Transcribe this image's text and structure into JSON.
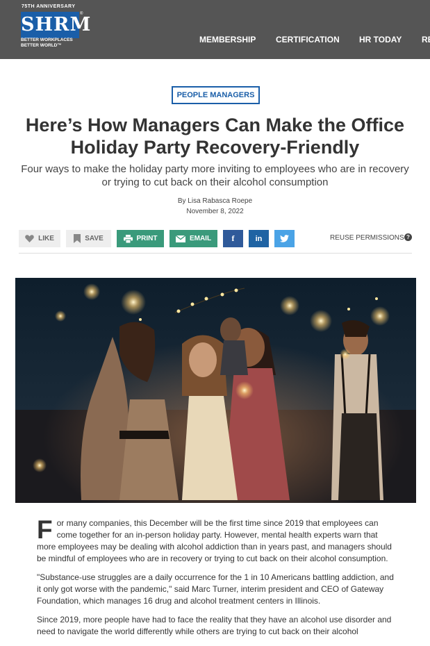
{
  "header": {
    "logo": {
      "anniversary": "75TH ANNIVERSARY",
      "wordmark": "SHRM",
      "registered": "®",
      "tagline_line1": "BETTER WORKPLACES",
      "tagline_line2": "BETTER WORLD™"
    },
    "nav": [
      "MEMBERSHIP",
      "CERTIFICATION",
      "HR TODAY",
      "RE"
    ],
    "background_color": "#555555",
    "brand_color": "#1a5ea8"
  },
  "article": {
    "category": "PEOPLE MANAGERS",
    "title_line1": "Here’s How Managers Can Make the Office",
    "title_line2": "Holiday Party Recovery-Friendly",
    "subtitle_line1": "Four ways to make the holiday party more inviting to employees who are in recovery",
    "subtitle_line2": "or trying to cut back on their alcohol consumption",
    "byline": "By Lisa Rabasca Roepe",
    "date": "November 8, 2022"
  },
  "actions": {
    "like": "LIKE",
    "save": "SAVE",
    "print": "PRINT",
    "email": "EMAIL",
    "facebook": "f",
    "linkedin": "in",
    "twitter_icon": "twitter-icon",
    "reuse": "REUSE PERMISSIONS",
    "help": "?",
    "colors": {
      "share_green": "#3a9a7b",
      "facebook": "#2f5a9a",
      "linkedin": "#1f63a3",
      "twitter": "#4aa3e6"
    }
  },
  "body": {
    "dropcap": "F",
    "paragraph1": "or many companies, this December will be the first time since 2019 that employees can come together for an in-person holiday party. However, mental health experts warn that more employees may be dealing with alcohol addiction than in years past, and managers should be mindful of employees who are in recovery or trying to cut back on their alcohol consumption.",
    "paragraph2": "\"Substance-use struggles are a daily occurrence for the 1 in 10 Americans battling addiction, and it only got worse with the pandemic,\" said Marc Turner, interim president and CEO of Gateway Foundation, which manages 16 drug and alcohol treatment centers in Illinois.",
    "paragraph3": "Since 2019, more people have had to face the reality that they have an alcohol use disorder and need to navigate the world differently while others are trying to cut back on their alcohol"
  }
}
